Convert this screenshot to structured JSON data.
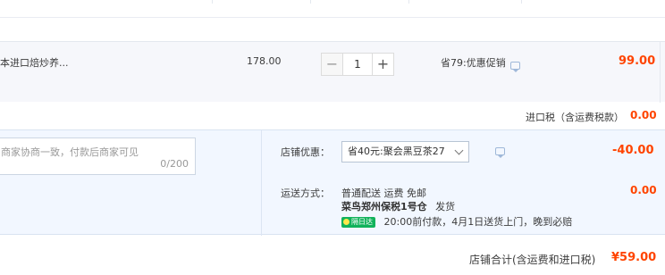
{
  "item": {
    "name": "本进口焙炒养...",
    "price": "178.00",
    "quantity": "1",
    "minus_label": "−",
    "plus_label": "+",
    "promo": "省79:优惠促销",
    "amount": "99.00"
  },
  "import_tax": {
    "label": "进口税（含运费税款）",
    "value": "0.00"
  },
  "memo": {
    "placeholder": "商家协商一致，付款后商家可见",
    "count": "0/200"
  },
  "shop_coupon": {
    "label": "店铺优惠：",
    "selected": "省40元:聚会黑豆茶27",
    "amount": "-40.00"
  },
  "shipping": {
    "label": "运送方式：",
    "method": "普通配送 运费 免邮",
    "amount": "0.00",
    "warehouse": "菜鸟郑州保税1号仓",
    "ship_text": "发货",
    "badge": "隔日达",
    "delivery_note": "20:00前付款，4月1日送货上门，晚到必赔"
  },
  "total": {
    "label": "店铺合计(含运费和进口税)",
    "value": "¥59.00"
  },
  "colors": {
    "accent_red": "#ff4400",
    "badge_green": "#11b25b",
    "panel_blue": "#f2f7ff"
  }
}
